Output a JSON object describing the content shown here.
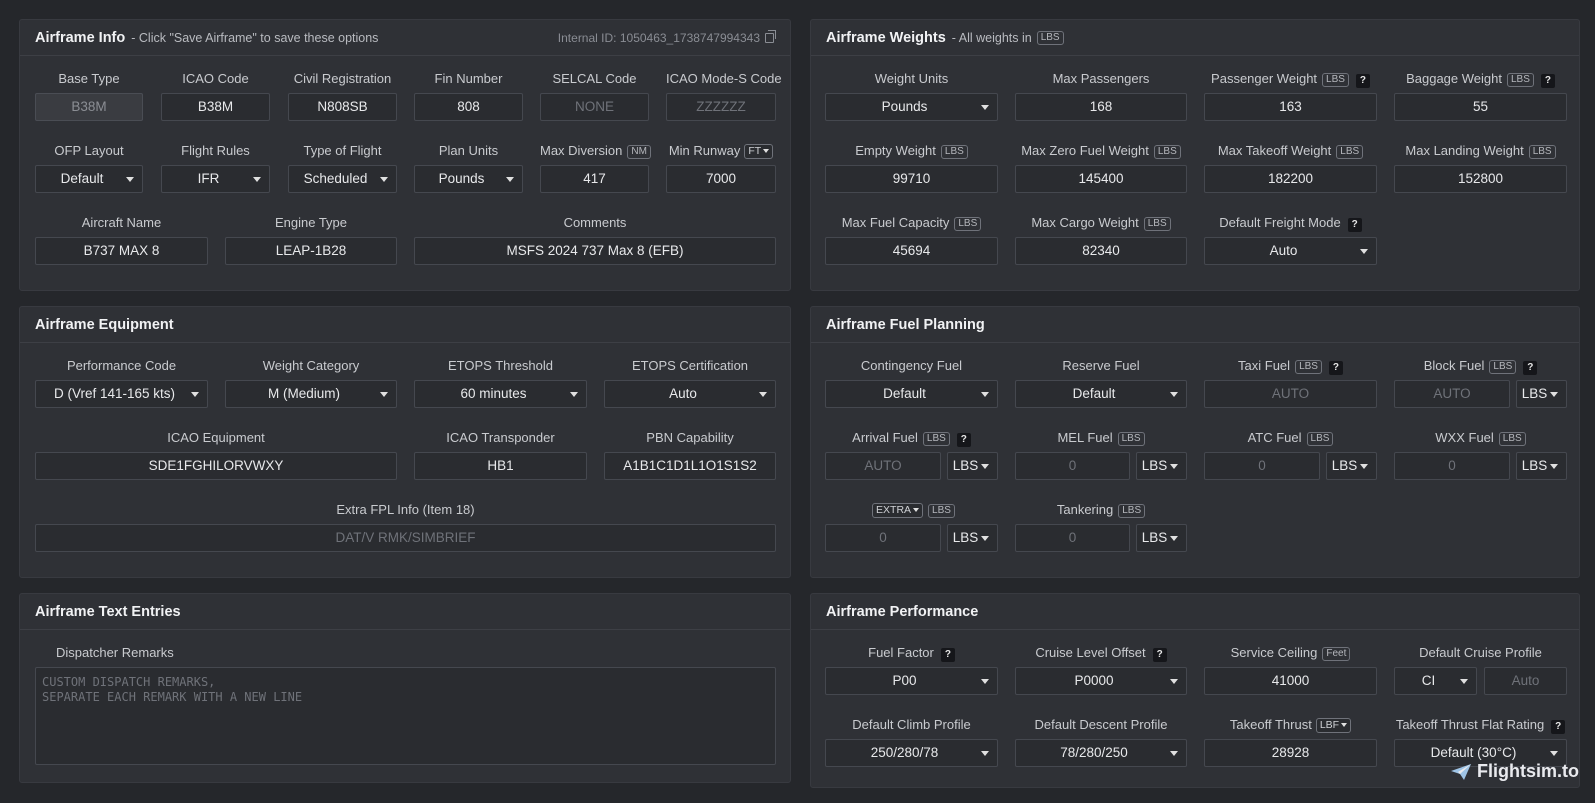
{
  "airframe_info": {
    "title": "Airframe Info",
    "subtitle": "- Click \"Save Airframe\" to save these options",
    "internal_id_label": "Internal ID:",
    "internal_id": "1050463_1738747994343",
    "base_type": {
      "label": "Base Type",
      "value": "B38M"
    },
    "icao_code": {
      "label": "ICAO Code",
      "value": "B38M"
    },
    "civil_registration": {
      "label": "Civil Registration",
      "value": "N808SB"
    },
    "fin_number": {
      "label": "Fin Number",
      "value": "808"
    },
    "selcal_code": {
      "label": "SELCAL Code",
      "placeholder": "NONE"
    },
    "mode_s_code": {
      "label": "ICAO Mode-S Code",
      "placeholder": "ZZZZZZ"
    },
    "ofp_layout": {
      "label": "OFP Layout",
      "value": "Default"
    },
    "flight_rules": {
      "label": "Flight Rules",
      "value": "IFR"
    },
    "type_of_flight": {
      "label": "Type of Flight",
      "value": "Scheduled"
    },
    "plan_units": {
      "label": "Plan Units",
      "value": "Pounds"
    },
    "max_diversion": {
      "label": "Max Diversion",
      "unit": "NM",
      "value": "417"
    },
    "min_runway": {
      "label": "Min Runway",
      "unit": "FT",
      "value": "7000"
    },
    "aircraft_name": {
      "label": "Aircraft Name",
      "value": "B737 MAX 8"
    },
    "engine_type": {
      "label": "Engine Type",
      "value": "LEAP-1B28"
    },
    "comments": {
      "label": "Comments",
      "value": "MSFS 2024 737 Max 8 (EFB)"
    }
  },
  "airframe_weights": {
    "title": "Airframe Weights",
    "subtitle": "- All weights in",
    "unit": "LBS",
    "weight_units": {
      "label": "Weight Units",
      "value": "Pounds"
    },
    "max_passengers": {
      "label": "Max Passengers",
      "value": "168"
    },
    "passenger_weight": {
      "label": "Passenger Weight",
      "value": "163"
    },
    "baggage_weight": {
      "label": "Baggage Weight",
      "value": "55"
    },
    "empty_weight": {
      "label": "Empty Weight",
      "value": "99710"
    },
    "max_zero_fuel_weight": {
      "label": "Max Zero Fuel Weight",
      "value": "145400"
    },
    "max_takeoff_weight": {
      "label": "Max Takeoff Weight",
      "value": "182200"
    },
    "max_landing_weight": {
      "label": "Max Landing Weight",
      "value": "152800"
    },
    "max_fuel_capacity": {
      "label": "Max Fuel Capacity",
      "value": "45694"
    },
    "max_cargo_weight": {
      "label": "Max Cargo Weight",
      "value": "82340"
    },
    "default_freight_mode": {
      "label": "Default Freight Mode",
      "value": "Auto"
    }
  },
  "airframe_equipment": {
    "title": "Airframe Equipment",
    "performance_code": {
      "label": "Performance Code",
      "value": "D (Vref 141-165 kts)"
    },
    "weight_category": {
      "label": "Weight Category",
      "value": "M (Medium)"
    },
    "etops_threshold": {
      "label": "ETOPS Threshold",
      "value": "60 minutes"
    },
    "etops_certification": {
      "label": "ETOPS Certification",
      "value": "Auto"
    },
    "icao_equipment": {
      "label": "ICAO Equipment",
      "value": "SDE1FGHILORVWXY"
    },
    "icao_transponder": {
      "label": "ICAO Transponder",
      "value": "HB1"
    },
    "pbn_capability": {
      "label": "PBN Capability",
      "value": "A1B1C1D1L1O1S1S2"
    },
    "extra_fpl": {
      "label": "Extra FPL Info (Item 18)",
      "placeholder": "DAT/V RMK/SIMBRIEF"
    }
  },
  "airframe_fuel": {
    "title": "Airframe Fuel Planning",
    "unit": "LBS",
    "contingency_fuel": {
      "label": "Contingency Fuel",
      "value": "Default"
    },
    "reserve_fuel": {
      "label": "Reserve Fuel",
      "value": "Default"
    },
    "taxi_fuel": {
      "label": "Taxi Fuel",
      "placeholder": "AUTO"
    },
    "block_fuel": {
      "label": "Block Fuel",
      "placeholder": "AUTO",
      "unit_select": "LBS"
    },
    "arrival_fuel": {
      "label": "Arrival Fuel",
      "placeholder": "AUTO",
      "unit_select": "LBS"
    },
    "mel_fuel": {
      "label": "MEL Fuel",
      "placeholder": "0",
      "unit_select": "LBS"
    },
    "atc_fuel": {
      "label": "ATC Fuel",
      "placeholder": "0",
      "unit_select": "LBS"
    },
    "wxx_fuel": {
      "label": "WXX Fuel",
      "placeholder": "0",
      "unit_select": "LBS"
    },
    "extra_fuel": {
      "label_select": "EXTRA",
      "placeholder": "0",
      "unit_select": "LBS"
    },
    "tankering": {
      "label": "Tankering",
      "placeholder": "0",
      "unit_select": "LBS"
    }
  },
  "airframe_text": {
    "title": "Airframe Text Entries",
    "dispatcher_remarks": {
      "label": "Dispatcher Remarks",
      "placeholder": "CUSTOM DISPATCH REMARKS,\nSEPARATE EACH REMARK WITH A NEW LINE"
    }
  },
  "airframe_performance": {
    "title": "Airframe Performance",
    "fuel_factor": {
      "label": "Fuel Factor",
      "value": "P00"
    },
    "cruise_level_offset": {
      "label": "Cruise Level Offset",
      "value": "P0000"
    },
    "service_ceiling": {
      "label": "Service Ceiling",
      "unit": "Feet",
      "value": "41000"
    },
    "default_cruise_profile": {
      "label": "Default Cruise Profile",
      "value": "CI",
      "placeholder": "Auto"
    },
    "default_climb_profile": {
      "label": "Default Climb Profile",
      "value": "250/280/78"
    },
    "default_descent_profile": {
      "label": "Default Descent Profile",
      "value": "78/280/250"
    },
    "takeoff_thrust": {
      "label": "Takeoff Thrust",
      "unit": "LBF",
      "value": "28928"
    },
    "takeoff_flat_rating": {
      "label": "Takeoff Thrust Flat Rating",
      "value": "Default (30°C)"
    }
  },
  "brand": {
    "name": "Flightsim.to"
  }
}
